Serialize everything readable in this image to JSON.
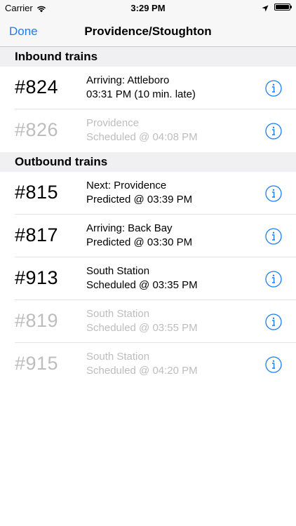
{
  "status_bar": {
    "carrier": "Carrier",
    "time": "3:29 PM",
    "battery_level": 1.0
  },
  "nav": {
    "done_label": "Done",
    "title": "Providence/Stoughton"
  },
  "sections": {
    "inbound": {
      "title": "Inbound trains",
      "rows": [
        {
          "number": "#824",
          "line1": "Arriving: Attleboro",
          "line2": "03:31 PM (10 min. late)",
          "active": true
        },
        {
          "number": "#826",
          "line1": "Providence",
          "line2": "Scheduled @ 04:08 PM",
          "active": false
        }
      ]
    },
    "outbound": {
      "title": "Outbound trains",
      "rows": [
        {
          "number": "#815",
          "line1": "Next: Providence",
          "line2": "Predicted @ 03:39 PM",
          "active": true
        },
        {
          "number": "#817",
          "line1": "Arriving: Back Bay",
          "line2": "Predicted @ 03:30 PM",
          "active": true
        },
        {
          "number": "#913",
          "line1": "South Station",
          "line2": "Scheduled @ 03:35 PM",
          "active": true
        },
        {
          "number": "#819",
          "line1": "South Station",
          "line2": "Scheduled @ 03:55 PM",
          "active": false
        },
        {
          "number": "#915",
          "line1": "South Station",
          "line2": "Scheduled @ 04:20 PM",
          "active": false
        }
      ]
    }
  },
  "colors": {
    "accent": "#1a7cf5",
    "inactive_text": "#bdbdbf",
    "section_bg": "#f0f0f2"
  },
  "icons": {
    "info": "info-circle-icon",
    "wifi": "wifi-icon",
    "location": "location-arrow-icon",
    "battery": "battery-icon"
  }
}
